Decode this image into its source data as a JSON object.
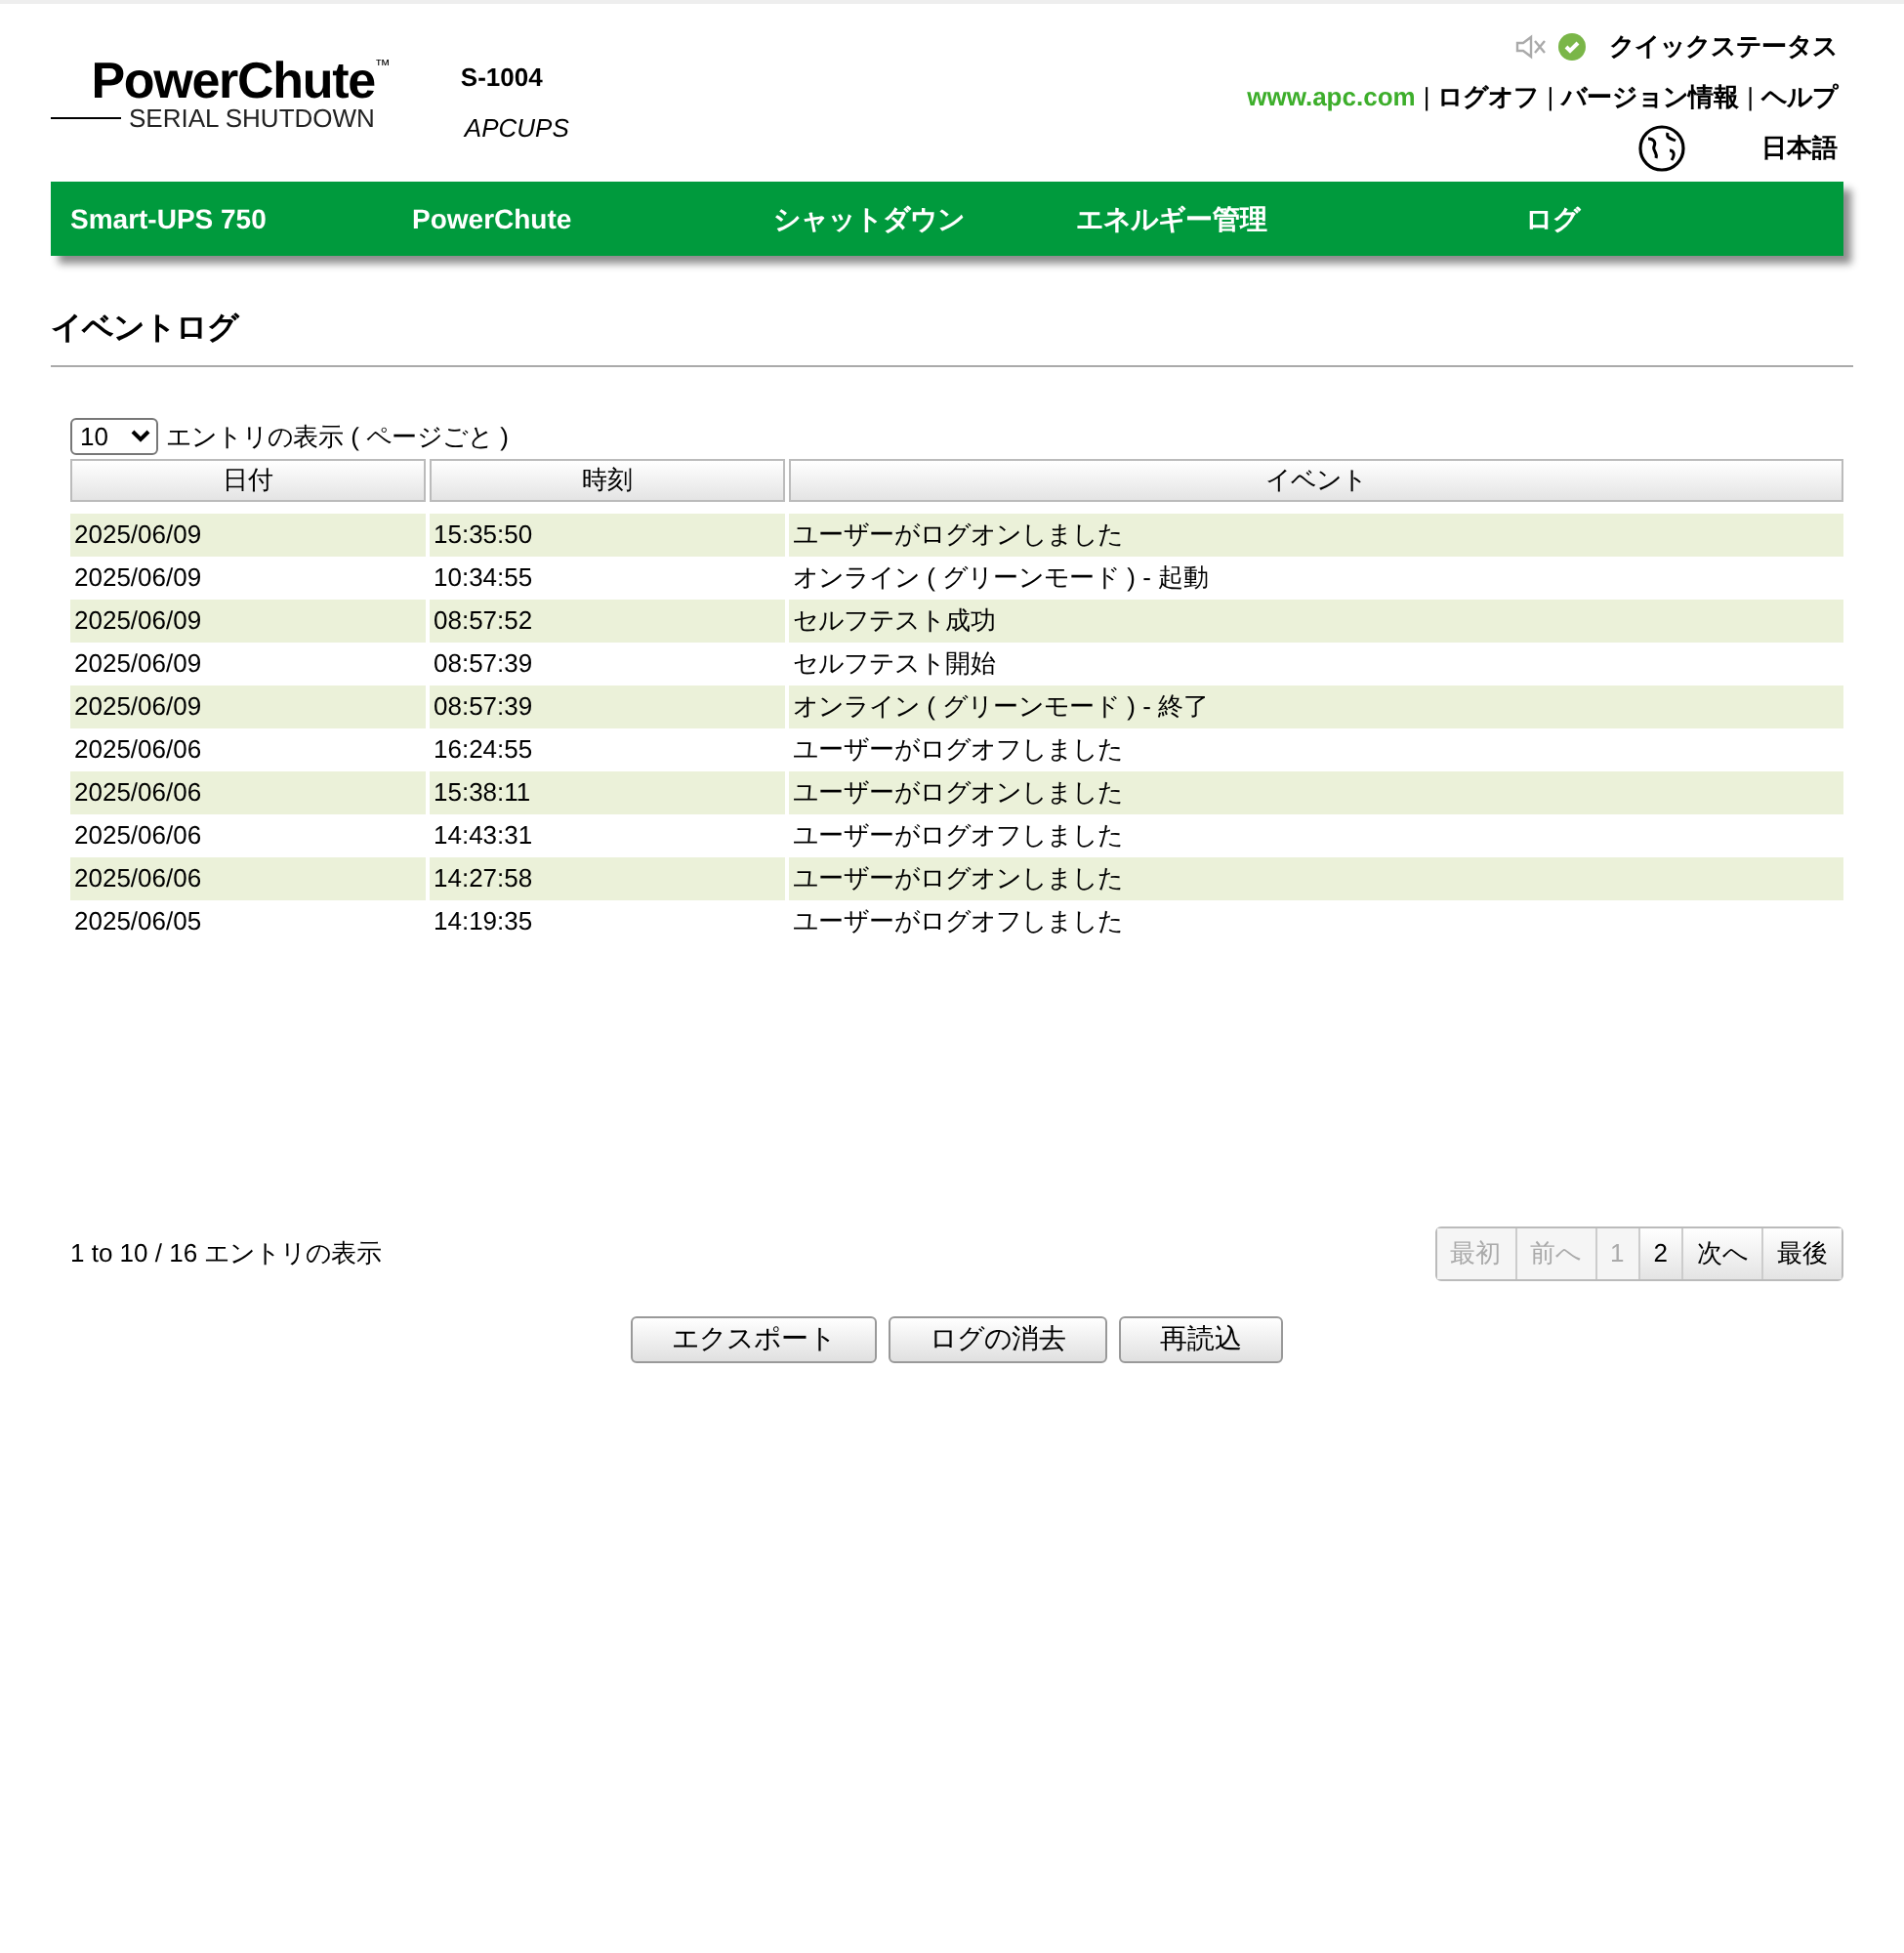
{
  "header": {
    "logo_title": "PowerChute",
    "logo_tm": "™",
    "logo_subtitle": "SERIAL SHUTDOWN",
    "device_model": "S-1004",
    "device_name": "APCUPS",
    "quick_status": "クイックステータス",
    "links": [
      {
        "label": "www.apc.com",
        "kind": "external"
      },
      {
        "label": "ログオフ",
        "kind": "plain"
      },
      {
        "label": "バージョン情報",
        "kind": "plain"
      },
      {
        "label": "ヘルプ",
        "kind": "plain"
      }
    ],
    "separators": [
      "|",
      "|",
      "|"
    ],
    "language": "日本語"
  },
  "nav": [
    "Smart-UPS 750",
    "PowerChute",
    "シャットダウン",
    "エネルギー管理",
    "ログ"
  ],
  "page_title": "イベントログ",
  "page_size": {
    "value": "10",
    "label": "エントリの表示 ( ページごと )"
  },
  "table": {
    "columns": [
      "日付",
      "時刻",
      "イベント"
    ],
    "rows": [
      [
        "2025/06/09",
        "15:35:50",
        "ユーザーがログオンしました"
      ],
      [
        "2025/06/09",
        "10:34:55",
        "オンライン ( グリーンモード ) - 起動"
      ],
      [
        "2025/06/09",
        "08:57:52",
        "セルフテスト成功"
      ],
      [
        "2025/06/09",
        "08:57:39",
        "セルフテスト開始"
      ],
      [
        "2025/06/09",
        "08:57:39",
        "オンライン ( グリーンモード ) - 終了"
      ],
      [
        "2025/06/06",
        "16:24:55",
        "ユーザーがログオフしました"
      ],
      [
        "2025/06/06",
        "15:38:11",
        "ユーザーがログオンしました"
      ],
      [
        "2025/06/06",
        "14:43:31",
        "ユーザーがログオフしました"
      ],
      [
        "2025/06/06",
        "14:27:58",
        "ユーザーがログオンしました"
      ],
      [
        "2025/06/05",
        "14:19:35",
        "ユーザーがログオフしました"
      ]
    ]
  },
  "info": "1 to 10 / 16 エントリの表示",
  "pagination": [
    {
      "label": "最初",
      "disabled": true
    },
    {
      "label": "前へ",
      "disabled": true
    },
    {
      "label": "1",
      "disabled": true
    },
    {
      "label": "2",
      "disabled": false
    },
    {
      "label": "次へ",
      "disabled": false
    },
    {
      "label": "最後",
      "disabled": false
    }
  ],
  "buttons": [
    "エクスポート",
    "ログの消去",
    "再読込"
  ]
}
